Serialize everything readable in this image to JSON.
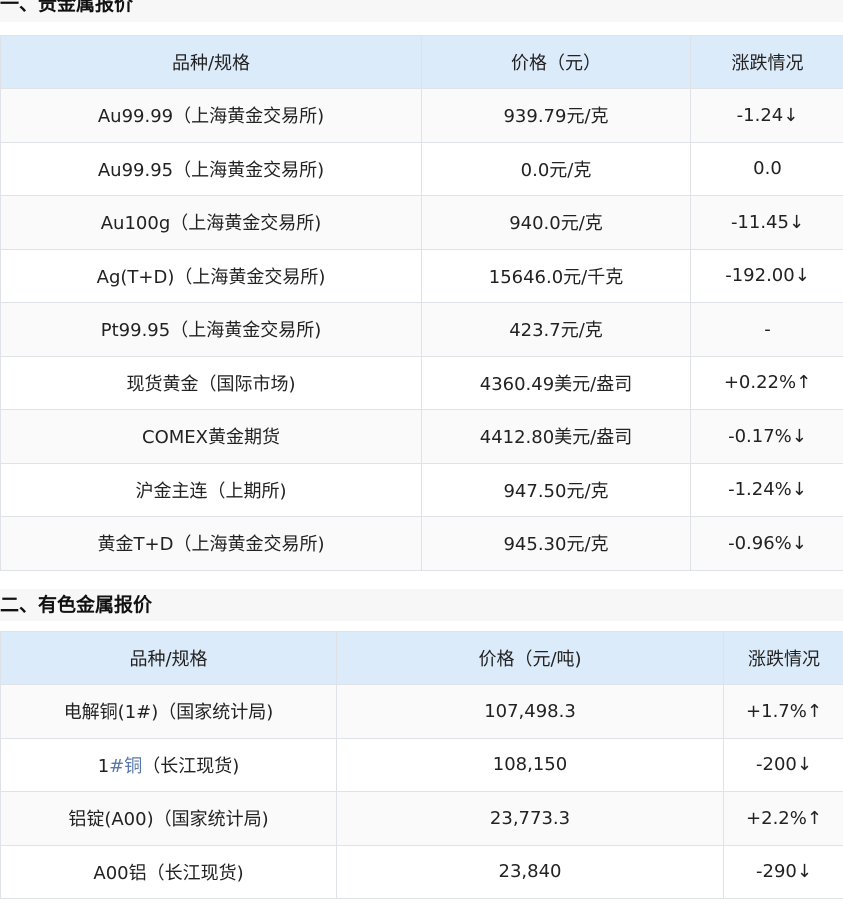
{
  "precious": {
    "title": "一、贵金属报价",
    "headers": [
      "品种/规格",
      "价格（元）",
      "涨跌情况"
    ],
    "rows": [
      [
        "Au99.99（上海黄金交易所)",
        "939.79元/克",
        "-1.24↓"
      ],
      [
        "Au99.95（上海黄金交易所)",
        "0.0元/克",
        "0.0"
      ],
      [
        "Au100g（上海黄金交易所)",
        "940.0元/克",
        "-11.45↓"
      ],
      [
        "Ag(T+D)（上海黄金交易所)",
        "15646.0元/千克",
        "-192.00↓"
      ],
      [
        "Pt99.95（上海黄金交易所)",
        "423.7元/克",
        "-"
      ],
      [
        "现货黄金（国际市场)",
        "4360.49美元/盎司",
        "+0.22%↑"
      ],
      [
        "COMEX黄金期货",
        "4412.80美元/盎司",
        "-0.17%↓"
      ],
      [
        "沪金主连（上期所)",
        "947.50元/克",
        "-1.24%↓"
      ],
      [
        "黄金T+D（上海黄金交易所)",
        "945.30元/克",
        "-0.96%↓"
      ]
    ]
  },
  "nonferrous": {
    "title": "二、有色金属报价",
    "headers": [
      "品种/规格",
      "价格（元/吨)",
      "涨跌情况"
    ],
    "rows": [
      [
        "电解铜(1#)（国家统计局)",
        "107,498.3",
        "+1.7%↑"
      ],
      [
        "1#铜（长江现货)",
        "108,150",
        "-200↓"
      ],
      [
        "铝锭(A00)（国家统计局)",
        "23,773.3",
        "+2.2%↑"
      ],
      [
        "A00铝（长江现货)",
        "23,840",
        "-290↓"
      ]
    ],
    "row2_prefix": "1",
    "row2_link": "#铜",
    "row2_suffix": "（长江现货)"
  }
}
